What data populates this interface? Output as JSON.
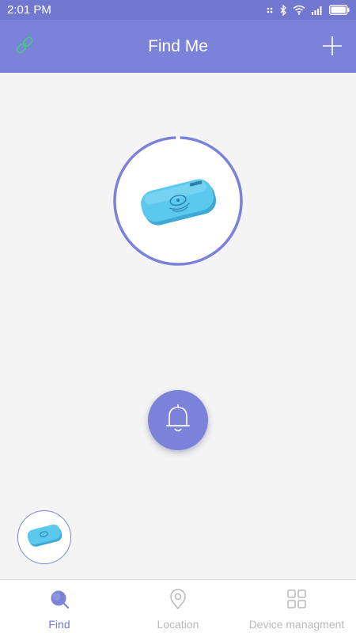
{
  "status_bar": {
    "time": "2:01 PM",
    "icons": [
      "signal-dots-icon",
      "bluetooth-icon",
      "wifi-icon",
      "cell-signal-icon",
      "battery-icon"
    ]
  },
  "app_bar": {
    "title": "Find Me",
    "left_icon": "link-icon",
    "right_icon": "plus-icon"
  },
  "main": {
    "device_image": "tracker-tag-image",
    "alarm_icon": "bell-icon"
  },
  "bottom_nav": {
    "items": [
      {
        "label": "Find",
        "icon": "search-icon",
        "active": true
      },
      {
        "label": "Location",
        "icon": "location-pin-icon",
        "active": false
      },
      {
        "label": "Device managment",
        "icon": "grid-icon",
        "active": false
      }
    ]
  },
  "colors": {
    "accent": "#7b82d9",
    "status_bar": "#7178cf",
    "link_icon": "#4cc38a",
    "device": "#5bc8ee",
    "nav_inactive": "#b9b9b9",
    "background": "#f4f4f4"
  }
}
